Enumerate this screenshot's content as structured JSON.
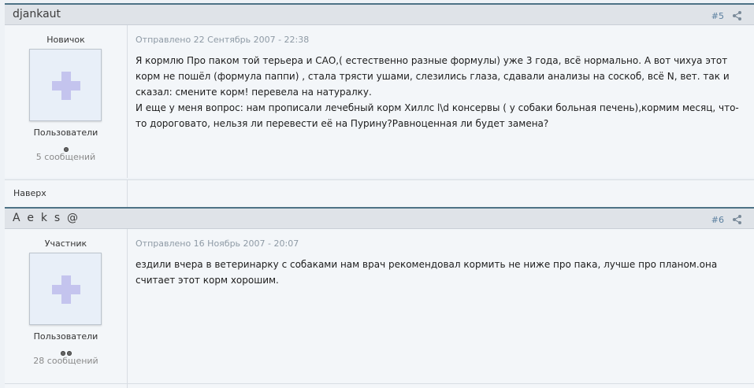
{
  "posts": [
    {
      "author": "djankaut",
      "number": "#5",
      "rank": "Новичок",
      "group": "Пользователи",
      "pips": 1,
      "post_count": "5 сообщений",
      "date": "Отправлено 22 Сентябрь 2007 - 22:38",
      "paragraphs": [
        "Я кормлю Про паком той терьера и САО,( естественно разные формулы) уже 3 года, всё нормально. А вот чихуа этот корм не пошёл (формула паппи) , стала трясти ушами, слезились глаза, сдавали анализы на соскоб, всё N, вет. так и сказал: смените корм! перевела на натуралку.",
        "И еще у меня вопрос: нам прописали лечебный корм Хиллс l\\d консервы ( у собаки больная печень),кормим месяц, что-то дороговато, нельзя ли перевести её на Пурину?Равноценная ли будет замена?"
      ]
    },
    {
      "author": "A e k s @",
      "number": "#6",
      "rank": "Участник",
      "group": "Пользователи",
      "pips": 2,
      "post_count": "28 сообщений",
      "date": "Отправлено 16 Ноябрь 2007 - 20:07",
      "paragraphs": [
        "ездили вчера в ветеринарку с собаками нам врач рекомендовал кормить не ниже про пака, лучше про планом.она считает этот корм хорошим."
      ]
    }
  ],
  "back_to_top": "Наверх",
  "icons": {
    "share": "share-icon",
    "avatar": "default-avatar-plus-icon",
    "pip": "rank-pip-icon"
  },
  "colors": {
    "header_bg": "#dfe3e8",
    "header_border": "#4d7286",
    "body_bg": "#f3f6f9",
    "link": "#5a7f9f"
  }
}
